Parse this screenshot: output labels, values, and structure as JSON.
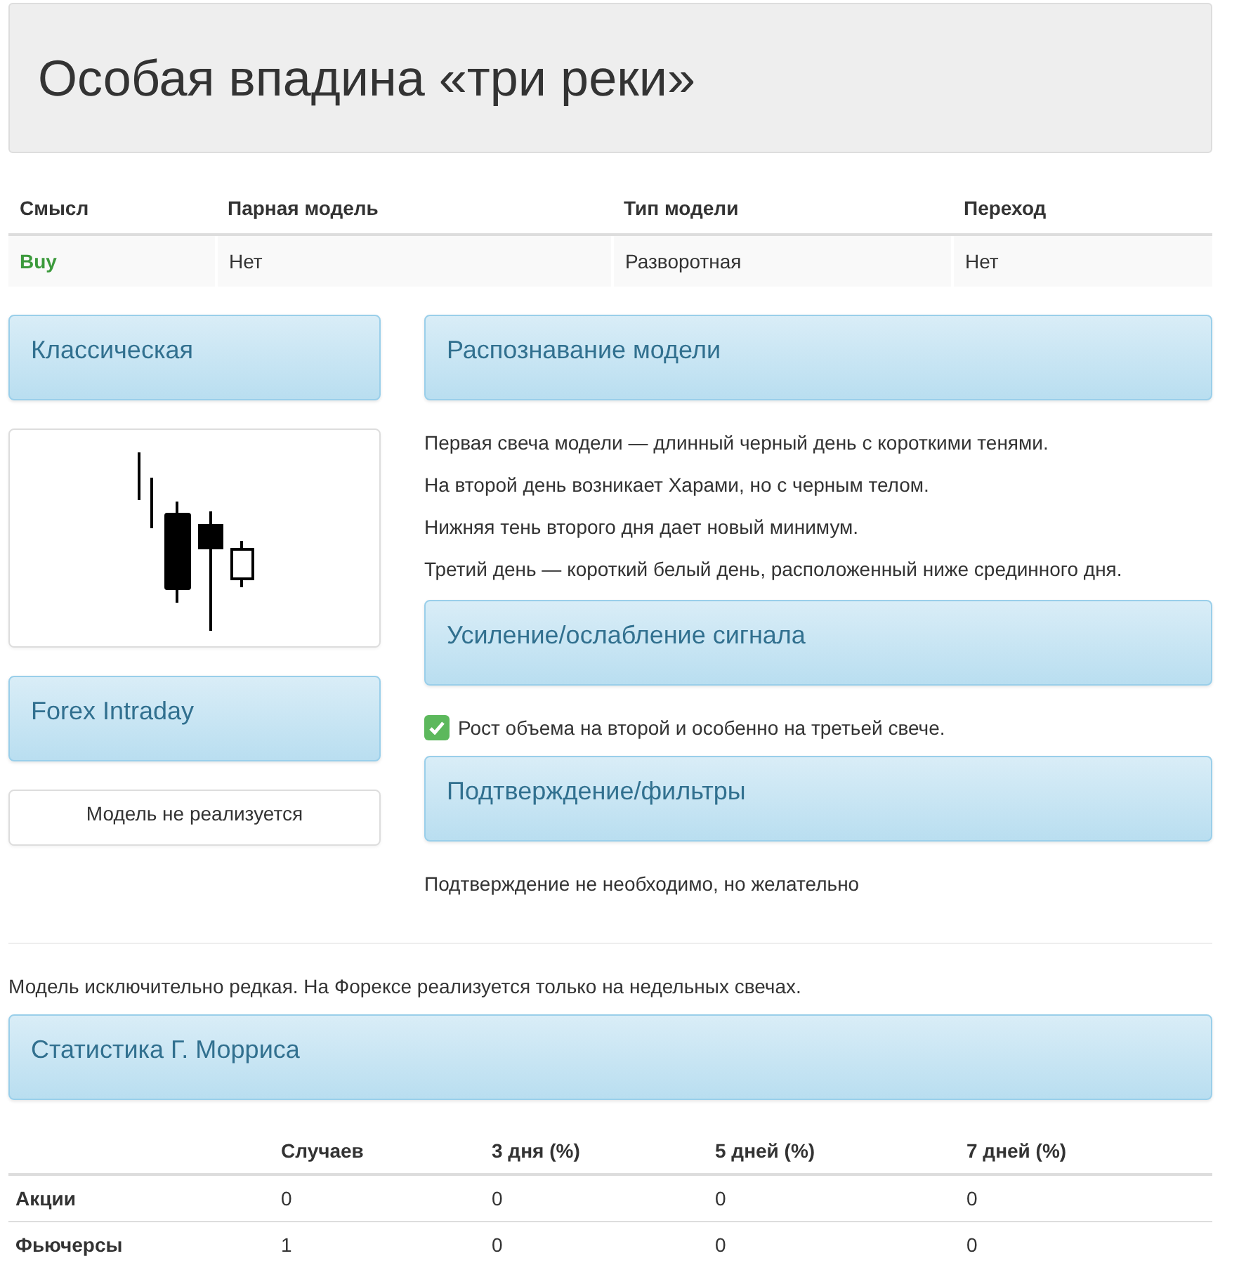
{
  "title": "Особая впадина «три реки»",
  "summary": {
    "columns": [
      "Смысл",
      "Парная модель",
      "Тип модели",
      "Переход"
    ],
    "row": [
      "Buy",
      "Нет",
      "Разворотная",
      "Нет"
    ]
  },
  "left": [
    {
      "kind": "heading",
      "text": "Классическая"
    },
    {
      "kind": "picture"
    },
    {
      "kind": "heading",
      "text": "Forex Intraday"
    },
    {
      "kind": "note",
      "text": "Модель не реализуется"
    }
  ],
  "right": [
    {
      "kind": "heading",
      "text": "Распознавание модели"
    },
    {
      "kind": "text",
      "text": "Первая свеча модели — длинный черный день с короткими тенями."
    },
    {
      "kind": "text",
      "text": "На второй день возникает Харами, но с черным телом."
    },
    {
      "kind": "text",
      "text": "Нижняя тень второго дня дает новый минимум."
    },
    {
      "kind": "text",
      "text": "Третий день — короткий белый день, расположенный ниже срединного дня."
    },
    {
      "kind": "heading",
      "text": "Усиление/ослабление сигнала"
    },
    {
      "kind": "check",
      "text": "Рост объема на второй и особенно на третьей свече.",
      "checked": true
    },
    {
      "kind": "heading",
      "text": "Подтверждение/фильтры"
    },
    {
      "kind": "text",
      "text": "Подтверждение не необходимо, но желательно"
    }
  ],
  "remark": "Модель исключительно редкая. На Форексе реализуется только на недельных свечах.",
  "stats_heading": "Статистика Г. Морриса",
  "stats": {
    "columns": [
      "Случаев",
      "3 дня (%)",
      "5 дней (%)",
      "7 дней (%)"
    ],
    "rows": [
      {
        "label": "Акции",
        "cells": [
          "0",
          "0",
          "0",
          "0"
        ]
      },
      {
        "label": "Фьючерсы",
        "cells": [
          "1",
          "0",
          "0",
          "0"
        ]
      }
    ]
  }
}
